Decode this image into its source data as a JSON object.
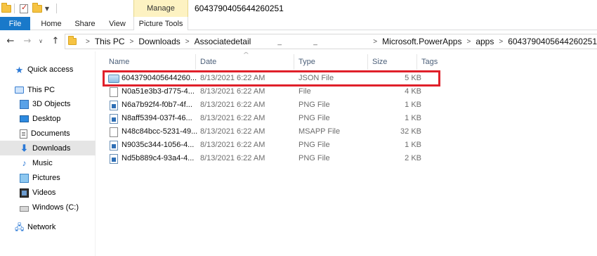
{
  "window": {
    "title": "6043790405644260251",
    "context_tab": "Manage"
  },
  "ribbon": {
    "tabs": [
      "File",
      "Home",
      "Share",
      "View",
      "Picture Tools"
    ]
  },
  "address": {
    "crumbs": [
      "This PC",
      "Downloads",
      "Associatedetail",
      "",
      "",
      "Microsoft.PowerApps",
      "apps",
      "6043790405644260251"
    ]
  },
  "nav": {
    "items": [
      {
        "label": "Quick access",
        "icon": "star-icon"
      },
      {
        "label": "This PC",
        "icon": "computer-icon"
      },
      {
        "label": "3D Objects",
        "icon": "cube-icon"
      },
      {
        "label": "Desktop",
        "icon": "desktop-icon"
      },
      {
        "label": "Documents",
        "icon": "documents-icon"
      },
      {
        "label": "Downloads",
        "icon": "download-arrow-icon",
        "selected": true
      },
      {
        "label": "Music",
        "icon": "music-note-icon"
      },
      {
        "label": "Pictures",
        "icon": "pictures-icon"
      },
      {
        "label": "Videos",
        "icon": "videos-icon"
      },
      {
        "label": "Windows (C:)",
        "icon": "drive-icon"
      },
      {
        "label": "Network",
        "icon": "network-icon"
      }
    ]
  },
  "columns": {
    "name": "Name",
    "date": "Date",
    "type": "Type",
    "size": "Size",
    "tags": "Tags"
  },
  "files": [
    {
      "name": "6043790405644260...",
      "date": "8/13/2021 6:22 AM",
      "type": "JSON File",
      "size": "5 KB",
      "icon": "json-file-icon",
      "highlighted": true
    },
    {
      "name": "N0a51e3b3-d775-4...",
      "date": "8/13/2021 6:22 AM",
      "type": "File",
      "size": "4 KB",
      "icon": "generic-file-icon"
    },
    {
      "name": "N6a7b92f4-f0b7-4f...",
      "date": "8/13/2021 6:22 AM",
      "type": "PNG File",
      "size": "1 KB",
      "icon": "png-file-icon"
    },
    {
      "name": "N8aff5394-037f-46...",
      "date": "8/13/2021 6:22 AM",
      "type": "PNG File",
      "size": "1 KB",
      "icon": "png-file-icon"
    },
    {
      "name": "N48c84bcc-5231-49...",
      "date": "8/13/2021 6:22 AM",
      "type": "MSAPP File",
      "size": "32 KB",
      "icon": "generic-file-icon"
    },
    {
      "name": "N9035c344-1056-4...",
      "date": "8/13/2021 6:22 AM",
      "type": "PNG File",
      "size": "1 KB",
      "icon": "png-file-icon"
    },
    {
      "name": "Nd5b889c4-93a4-4...",
      "date": "8/13/2021 6:22 AM",
      "type": "PNG File",
      "size": "2 KB",
      "icon": "png-file-icon"
    }
  ],
  "colors": {
    "file_tab": "#1979ca",
    "manage_tab": "#fdf2c2",
    "highlight_box": "#e0202a",
    "selected_nav": "#e5e5e5"
  }
}
